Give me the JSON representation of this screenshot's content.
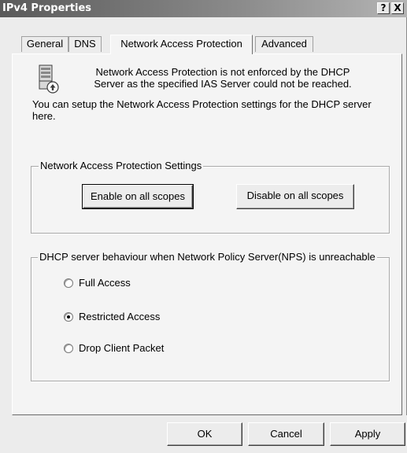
{
  "window": {
    "title": "IPv4 Properties",
    "help_label": "?",
    "close_label": "X"
  },
  "tabs": [
    {
      "label": "General",
      "active": false
    },
    {
      "label": "DNS",
      "active": false
    },
    {
      "label": "Network Access Protection",
      "active": true
    },
    {
      "label": "Advanced",
      "active": false
    }
  ],
  "info": {
    "message": "Network Access Protection is not enforced by the DHCP Server as the specified IAS Server could not be reached.",
    "icon": "server-warning-icon"
  },
  "description": "You can setup the Network Access Protection settings for the DHCP server here.",
  "nap_settings": {
    "legend": "Network Access Protection Settings",
    "enable_label": "Enable on all scopes",
    "disable_label": "Disable on all scopes"
  },
  "behaviour": {
    "legend": "DHCP server behaviour when Network Policy Server(NPS) is unreachable",
    "options": [
      {
        "label": "Full Access",
        "selected": false
      },
      {
        "label": "Restricted Access",
        "selected": true
      },
      {
        "label": "Drop Client Packet",
        "selected": false
      }
    ]
  },
  "buttons": {
    "ok": "OK",
    "cancel": "Cancel",
    "apply": "Apply"
  }
}
